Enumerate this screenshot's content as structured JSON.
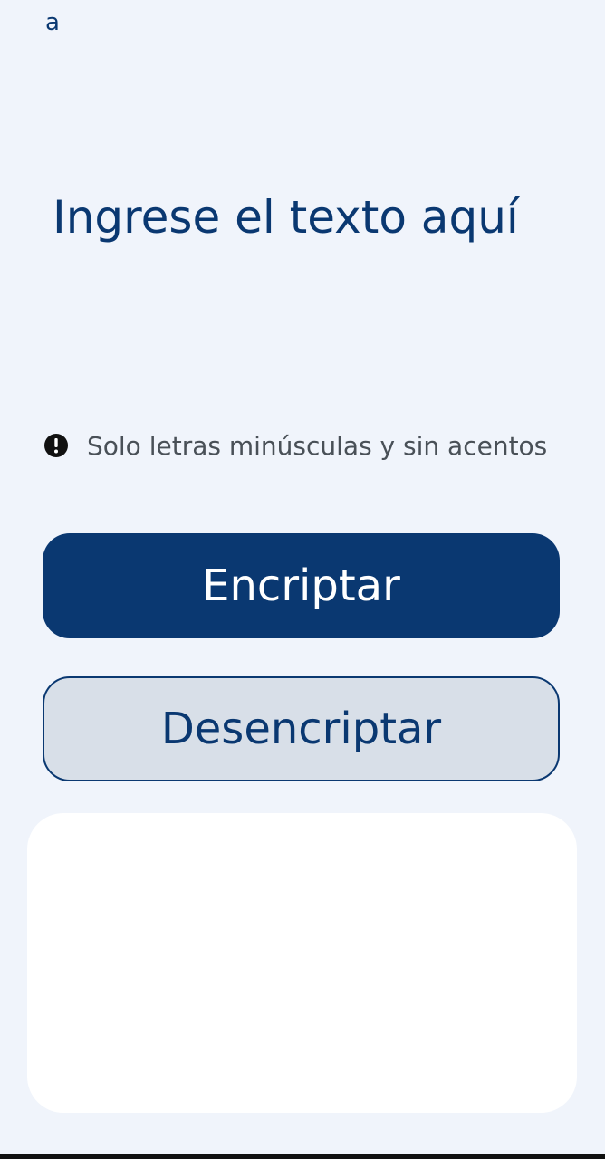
{
  "header": {
    "logo_text": "a"
  },
  "input": {
    "placeholder": "Ingrese el texto aquí",
    "value": ""
  },
  "hint": {
    "icon": "exclamation-circle-icon",
    "text": "Solo letras minúsculas y sin acentos"
  },
  "actions": {
    "encrypt_label": "Encriptar",
    "decrypt_label": "Desencriptar"
  },
  "output": {
    "text": ""
  },
  "colors": {
    "background": "#f0f4fb",
    "primary": "#0a3871",
    "secondary_button": "#d8dfe8",
    "hint_text": "#495057",
    "panel": "#ffffff"
  }
}
